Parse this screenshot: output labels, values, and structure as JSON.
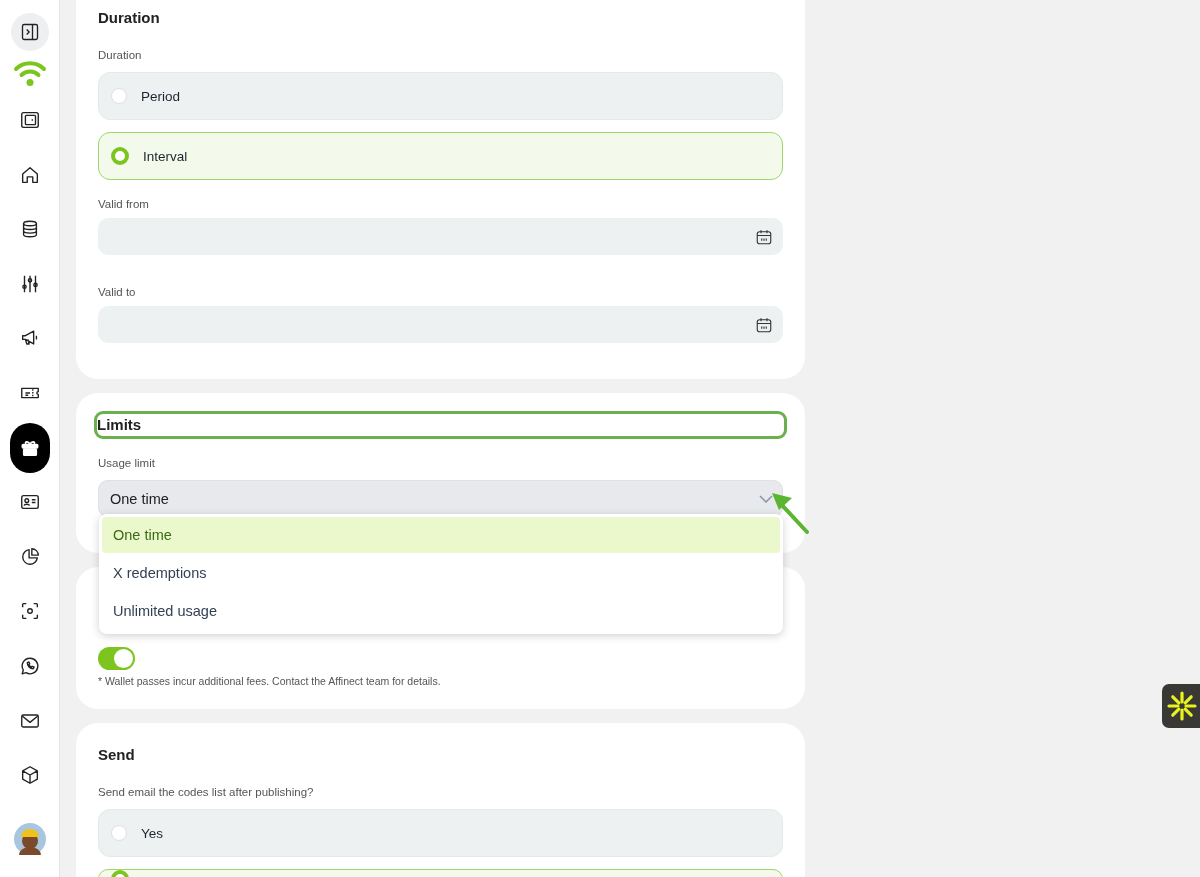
{
  "sidebar": {
    "items": [
      {
        "selected": false
      },
      {
        "selected": false
      },
      {
        "selected": false
      },
      {
        "selected": false
      },
      {
        "selected": false
      },
      {
        "selected": false
      },
      {
        "selected": true
      },
      {
        "selected": false
      },
      {
        "selected": false
      },
      {
        "selected": false
      },
      {
        "selected": false
      },
      {
        "selected": false
      },
      {
        "selected": false
      }
    ]
  },
  "duration": {
    "heading": "Duration",
    "label": "Duration",
    "options": [
      {
        "label": "Period",
        "selected": false
      },
      {
        "label": "Interval",
        "selected": true
      }
    ],
    "fields": [
      {
        "label": "Valid from"
      },
      {
        "label": "Valid to"
      }
    ]
  },
  "limits": {
    "heading": "Limits",
    "highlighted": true,
    "label": "Usage limit",
    "value": "One time",
    "open": true,
    "options": [
      {
        "label": "One time",
        "selected": true
      },
      {
        "label": "X redemptions",
        "selected": false
      },
      {
        "label": "Unlimited usage",
        "selected": false
      }
    ]
  },
  "wallet": {
    "on": true,
    "note": "* Wallet passes incur additional fees. Contact the Affinect team for details."
  },
  "send": {
    "heading": "Send",
    "label": "Send email the codes list after publishing?",
    "options": [
      {
        "label": "Yes",
        "selected": false
      },
      {
        "selected": true
      }
    ]
  }
}
